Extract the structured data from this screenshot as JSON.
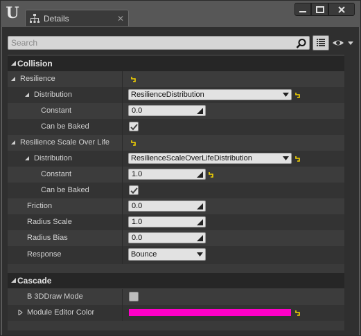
{
  "window": {
    "tab": {
      "label": "Details",
      "icon": "hierarchy-icon"
    },
    "controls": {
      "minimize_icon": "minimize-icon",
      "maximize_icon": "maximize-icon",
      "close_icon": "close-icon"
    }
  },
  "toolbar": {
    "search": {
      "placeholder": "Search",
      "value": ""
    },
    "icons": [
      "search-icon",
      "view-options-icon",
      "eye-icon"
    ]
  },
  "colors": {
    "module_editor_color": "#ff00c8",
    "reset_arrow": "#f5d400"
  },
  "categories": [
    {
      "label": "Collision",
      "expanded": true,
      "properties": [
        {
          "name": "Resilience",
          "type": "group",
          "expanded": true
        },
        {
          "name": "Distribution",
          "type": "combo",
          "value": "ResilienceDistribution"
        },
        {
          "name": "Constant",
          "type": "number",
          "value": "0.0"
        },
        {
          "name": "Can be Baked",
          "type": "checkbox",
          "checked": true
        },
        {
          "name": "Resilience Scale Over Life",
          "type": "group",
          "expanded": true
        },
        {
          "name": "Distribution",
          "type": "combo",
          "value": "ResilienceScaleOverLifeDistribution"
        },
        {
          "name": "Constant",
          "type": "number",
          "value": "1.0"
        },
        {
          "name": "Can be Baked",
          "type": "checkbox",
          "checked": true
        },
        {
          "name": "Friction",
          "type": "number",
          "value": "0.0"
        },
        {
          "name": "Radius Scale",
          "type": "number",
          "value": "1.0"
        },
        {
          "name": "Radius Bias",
          "type": "number",
          "value": "0.0"
        },
        {
          "name": "Response",
          "type": "combo",
          "value": "Bounce"
        }
      ]
    },
    {
      "label": "Cascade",
      "expanded": true,
      "properties": [
        {
          "name": "B 3DDraw Mode",
          "type": "checkbox",
          "checked": false
        },
        {
          "name": "Module Editor Color",
          "type": "color",
          "value": "#ff00c8",
          "expanded": false
        }
      ]
    }
  ]
}
